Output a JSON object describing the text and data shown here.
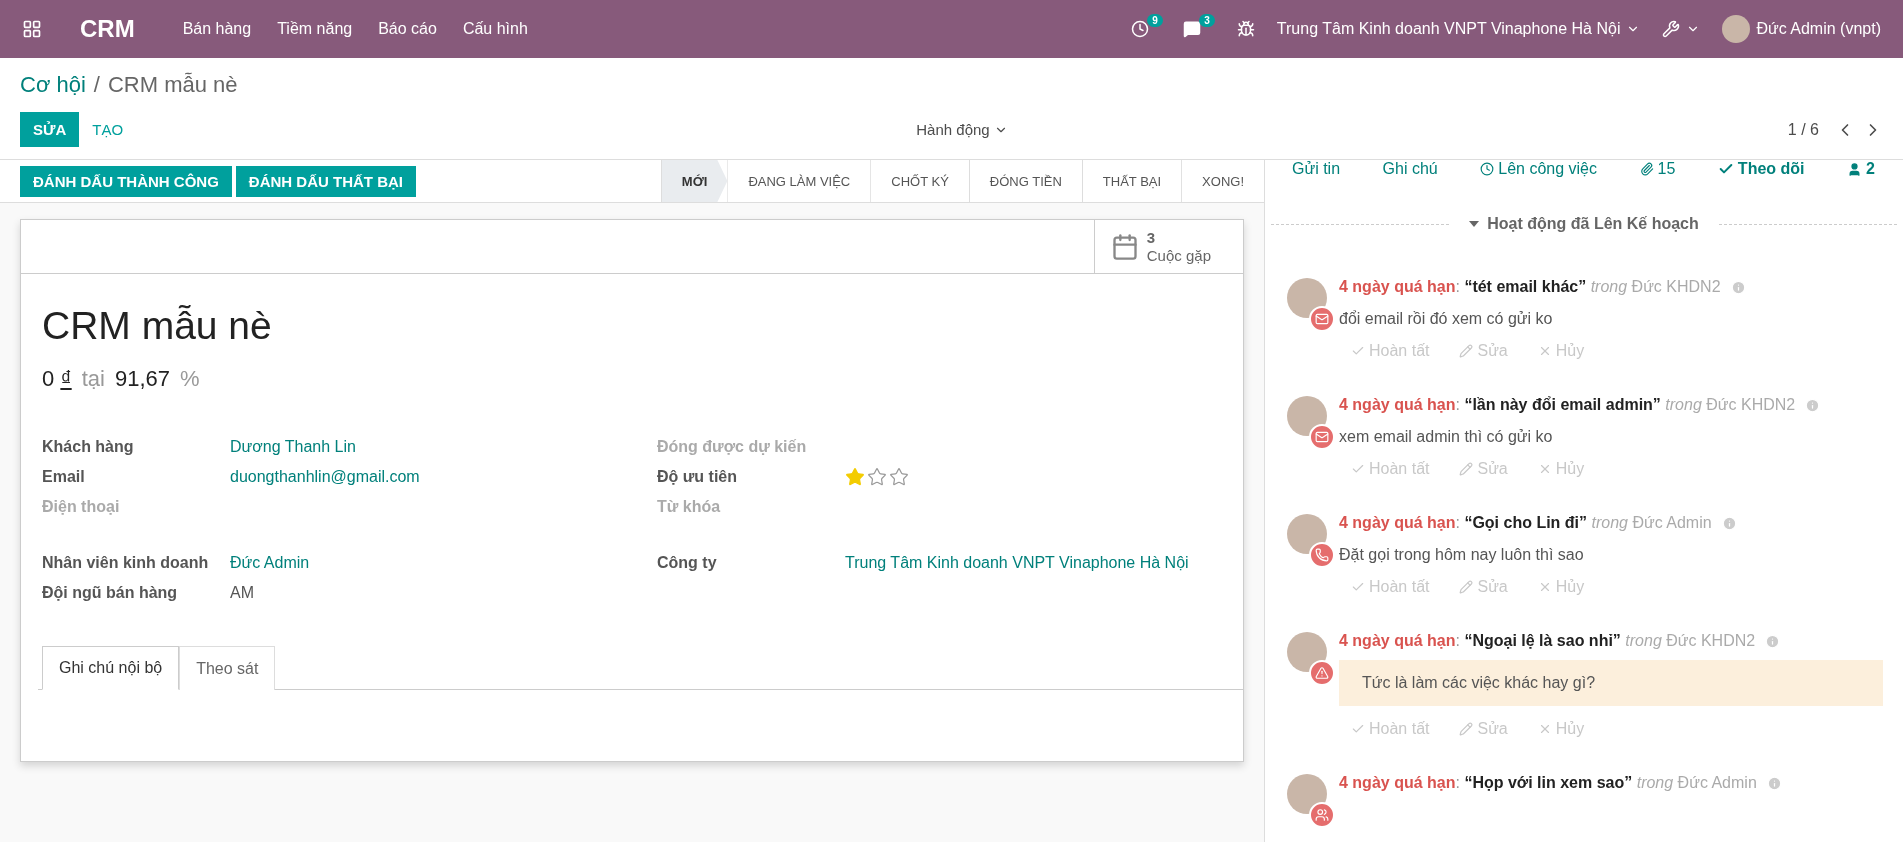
{
  "navbar": {
    "app": "CRM",
    "menus": [
      "Bán hàng",
      "Tiềm năng",
      "Báo cáo",
      "Cấu hình"
    ],
    "activity_count": "9",
    "message_count": "3",
    "company": "Trung Tâm Kinh doanh VNPT Vinaphone Hà Nội",
    "user": "Đức Admin (vnpt)"
  },
  "breadcrumb": {
    "parent": "Cơ hội",
    "separator": "/",
    "current": "CRM mẫu nè"
  },
  "control_panel": {
    "edit": "SỬA",
    "create": "TẠO",
    "action": "Hành động",
    "pager": "1 / 6"
  },
  "header_buttons": [
    "ĐÁNH DẤU THÀNH CÔNG",
    "ĐÁNH DẤU THẤT BẠI"
  ],
  "stages": [
    {
      "label": "MỚI",
      "selected": true
    },
    {
      "label": "ĐANG LÀM VIỆC",
      "selected": false
    },
    {
      "label": "CHỐT KÝ",
      "selected": false
    },
    {
      "label": "ĐÓNG TIỀN",
      "selected": false
    },
    {
      "label": "THẤT BẠI",
      "selected": false
    },
    {
      "label": "XONG!",
      "selected": false
    }
  ],
  "smart_button": {
    "count": "3",
    "label": "Cuộc gặp"
  },
  "record": {
    "title": "CRM mẫu nè",
    "revenue": "0",
    "currency": "₫",
    "at": "tại",
    "probability": "91,67",
    "percent": "%"
  },
  "left_fields": [
    {
      "label": "Khách hàng",
      "value": "Dương Thanh Lin",
      "kind": "link",
      "muted": false
    },
    {
      "label": "Email",
      "value": "duongthanhlin@gmail.com",
      "kind": "link",
      "muted": false
    },
    {
      "label": "Điện thoại",
      "muted": true,
      "kind": "empty"
    },
    {
      "kind": "spacer"
    },
    {
      "label": "Nhân viên kinh doanh",
      "value": "Đức Admin",
      "kind": "link",
      "muted": false
    },
    {
      "label": "Đội ngũ bán hàng",
      "value": "AM",
      "kind": "text",
      "muted": false
    }
  ],
  "right_fields": [
    {
      "label": "Đóng được dự kiến",
      "muted": true,
      "kind": "empty"
    },
    {
      "label": "Độ ưu tiên",
      "kind": "stars",
      "stars": 1,
      "muted": false
    },
    {
      "label": "Từ khóa",
      "muted": true,
      "kind": "empty"
    },
    {
      "kind": "spacer"
    },
    {
      "label": "Công ty",
      "value": "Trung Tâm Kinh doanh VNPT Vinaphone Hà Nội",
      "kind": "link",
      "muted": false
    }
  ],
  "notebook_tabs": [
    {
      "label": "Ghi chú nội bộ",
      "selected": true
    },
    {
      "label": "Theo sát",
      "selected": false
    }
  ],
  "chatter": {
    "send": "Gửi tin",
    "note": "Ghi chú",
    "schedule": "Lên công việc",
    "attachments": "15",
    "follow": "Theo dõi",
    "followers": "2",
    "section": "Hoạt động đã Lên Kế hoạch"
  },
  "activities": [
    {
      "due": "4 ngày quá hạn",
      "colon": ":",
      "summary": "“tét email khác”",
      "in": "trong",
      "assignee": "Đức KHDN2",
      "note": "đổi email rồi đó xem có gửi ko",
      "kind": "email",
      "actions": [
        "Hoàn tất",
        "Sửa",
        "Hủy"
      ]
    },
    {
      "due": "4 ngày quá hạn",
      "colon": ":",
      "summary": "“lần này đổi email admin”",
      "in": "trong",
      "assignee": "Đức KHDN2",
      "note": "xem email admin thì có gửi ko",
      "kind": "email",
      "actions": [
        "Hoàn tất",
        "Sửa",
        "Hủy"
      ]
    },
    {
      "due": "4 ngày quá hạn",
      "colon": ":",
      "summary": "“Gọi cho Lin đi”",
      "in": "trong",
      "assignee": "Đức Admin",
      "note": "Đặt gọi trong hôm nay luôn thì sao",
      "kind": "call",
      "actions": [
        "Hoàn tất",
        "Sửa",
        "Hủy"
      ]
    },
    {
      "due": "4 ngày quá hạn",
      "colon": ":",
      "summary": "“Ngoại lệ là sao nhỉ”",
      "in": "trong",
      "assignee": "Đức KHDN2",
      "note": "Tức là làm các việc khác hay gì?",
      "kind": "exception",
      "highlighted": true,
      "actions": [
        "Hoàn tất",
        "Sửa",
        "Hủy"
      ]
    },
    {
      "due": "4 ngày quá hạn",
      "colon": ":",
      "summary": "“Họp với lin xem sao”",
      "in": "trong",
      "assignee": "Đức Admin",
      "kind": "meeting"
    }
  ]
}
